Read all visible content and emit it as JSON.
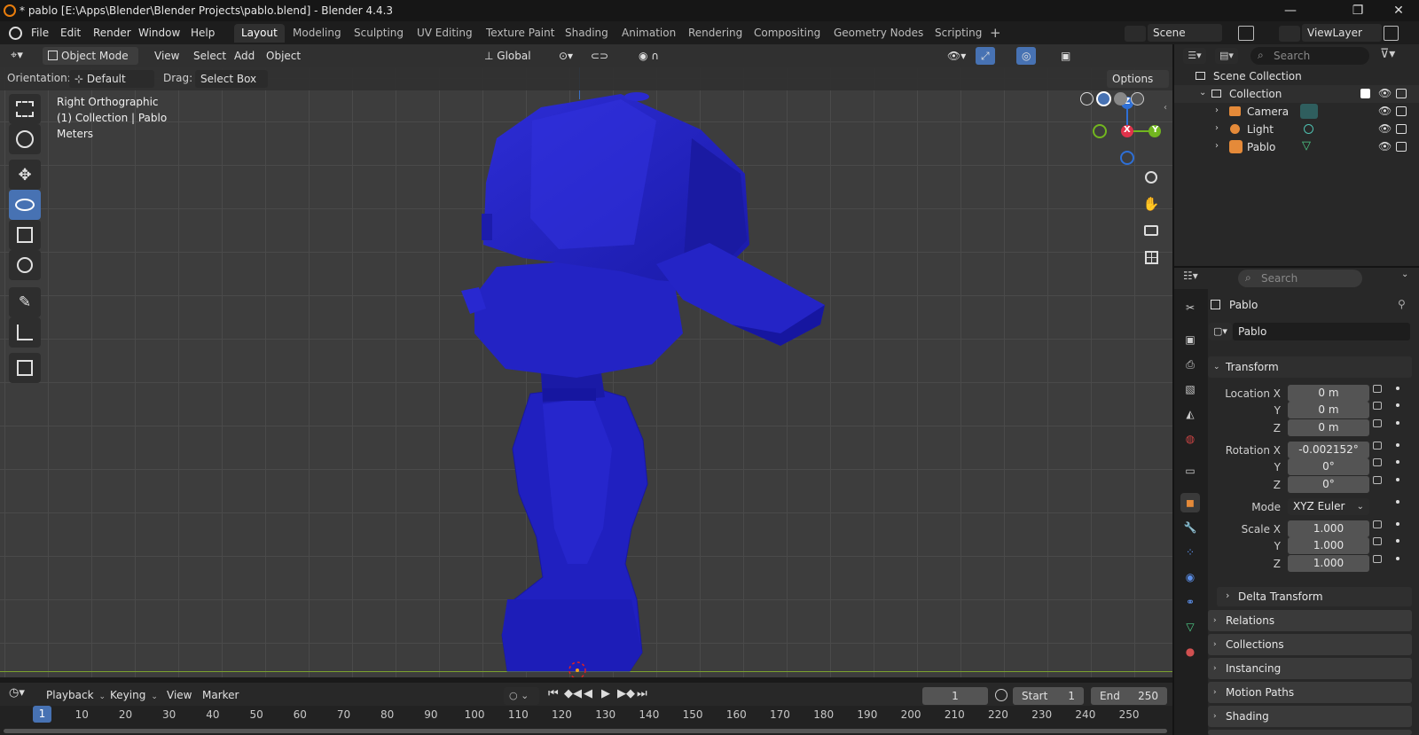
{
  "window": {
    "title": "* pablo [E:\\Apps\\Blender\\Blender Projects\\pablo.blend] - Blender 4.4.3",
    "minimize": "—",
    "maximize": "❐",
    "close": "✕"
  },
  "menu": {
    "items": [
      "File",
      "Edit",
      "Render",
      "Window",
      "Help"
    ]
  },
  "workspaces": [
    "Layout",
    "Modeling",
    "Sculpting",
    "UV Editing",
    "Texture Paint",
    "Shading",
    "Animation",
    "Rendering",
    "Compositing",
    "Geometry Nodes",
    "Scripting"
  ],
  "workspace_add": "+",
  "scene": {
    "name": "Scene",
    "view_layer": "ViewLayer"
  },
  "viewport_header": {
    "mode": "Object Mode",
    "menus": [
      "View",
      "Select",
      "Add",
      "Object"
    ],
    "transform_orientation": "Global",
    "options_label": "Options"
  },
  "tool_settings": {
    "orientation_label": "Orientation:",
    "orientation_value": "Default",
    "drag_label": "Drag:",
    "drag_value": "Select Box"
  },
  "viewport_info": {
    "view": "Right Orthographic",
    "collection": "(1) Collection | Pablo",
    "units": "Meters"
  },
  "gizmo": {
    "z": "Z",
    "x": "X",
    "y": "Y"
  },
  "outliner": {
    "search_placeholder": "Search",
    "scene_collection": "Scene Collection",
    "collection": "Collection",
    "objects": [
      "Camera",
      "Light",
      "Pablo"
    ]
  },
  "properties": {
    "search_placeholder": "Search",
    "object_name": "Pablo",
    "datablock_name": "Pablo",
    "transform_title": "Transform",
    "location_label": "Location X",
    "rotation_label": "Rotation X",
    "scale_label": "Scale X",
    "y_label": "Y",
    "z_label": "Z",
    "mode_label": "Mode",
    "location": [
      "0 m",
      "0 m",
      "0 m"
    ],
    "rotation": [
      "-0.002152°",
      "0°",
      "0°"
    ],
    "rotation_mode": "XYZ Euler",
    "scale": [
      "1.000",
      "1.000",
      "1.000"
    ],
    "subpanels": [
      "Delta Transform"
    ],
    "panels": [
      "Relations",
      "Collections",
      "Instancing",
      "Motion Paths",
      "Shading"
    ]
  },
  "timeline": {
    "menus": [
      "Playback",
      "Keying",
      "View",
      "Marker"
    ],
    "current_frame": "1",
    "start_label": "Start",
    "start": "1",
    "end_label": "End",
    "end": "250",
    "ruler": [
      "1",
      "10",
      "20",
      "30",
      "40",
      "50",
      "60",
      "70",
      "80",
      "90",
      "100",
      "110",
      "120",
      "130",
      "140",
      "150",
      "160",
      "170",
      "180",
      "190",
      "200",
      "210",
      "220",
      "230",
      "240",
      "250"
    ]
  },
  "colors": {
    "accent": "#4772b3",
    "mesh": "#2222c8",
    "x_axis": "#e0334b",
    "y_axis": "#72b61f",
    "z_axis": "#2e6fd6",
    "frame_marker": "#4772b3"
  }
}
